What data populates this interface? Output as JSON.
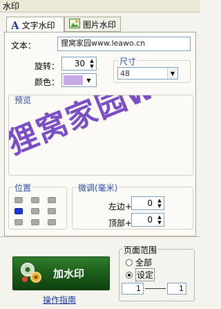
{
  "window": {
    "title": "水印"
  },
  "tabs": [
    {
      "label": "文字水印",
      "icon": "letter-a-icon",
      "active": true
    },
    {
      "label": "图片水印",
      "icon": "image-icon",
      "active": false
    }
  ],
  "text_field": {
    "label": "文本：",
    "value": "狸窝家园www.leawo.cn"
  },
  "rotation": {
    "label": "旋转：",
    "value": "30"
  },
  "color": {
    "label": "颜色：",
    "swatch": "#c9a8e8"
  },
  "size": {
    "title": "尺寸",
    "value": "48"
  },
  "preview": {
    "title": "预览",
    "watermark_text": "狸窝家园www.le",
    "watermark_color": "#7a4fc6"
  },
  "position": {
    "title": "位置",
    "selected_index": 3
  },
  "fine_tune": {
    "title": "微调(毫米)",
    "left_label": "左边+",
    "left_value": "0",
    "top_label": "顶部+",
    "top_value": "0"
  },
  "apply_button": {
    "label": "加水印"
  },
  "guide_link": {
    "label": "操作指南"
  },
  "page_range": {
    "title": "页面范围",
    "option_all": "全部",
    "option_set": "设定",
    "selected": "设定",
    "from": "1",
    "to": "1"
  }
}
